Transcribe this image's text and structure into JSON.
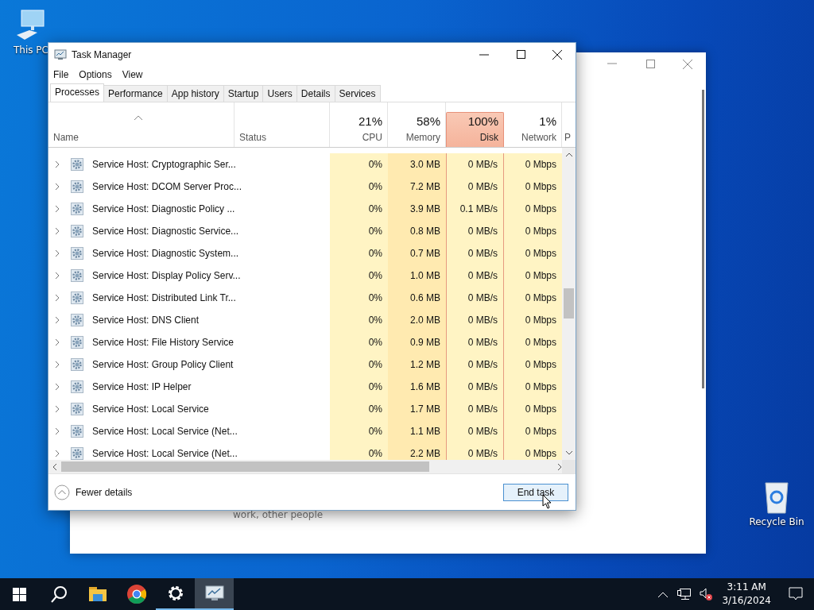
{
  "desktop_icons": [
    {
      "kind": "computer",
      "label": "This PC"
    },
    {
      "kind": "recycle",
      "label": "Recycle Bin"
    }
  ],
  "background_window": {
    "text": "work, other people"
  },
  "window": {
    "title": "Task Manager"
  },
  "menu": [
    "File",
    "Options",
    "View"
  ],
  "tabs": [
    {
      "label": "Processes",
      "selected": true
    },
    {
      "label": "Performance",
      "selected": false
    },
    {
      "label": "App history",
      "selected": false
    },
    {
      "label": "Startup",
      "selected": false
    },
    {
      "label": "Users",
      "selected": false
    },
    {
      "label": "Details",
      "selected": false
    },
    {
      "label": "Services",
      "selected": false
    }
  ],
  "columns": [
    {
      "label": "Name",
      "alert": false
    },
    {
      "label": "Status",
      "alert": false
    },
    {
      "label": "CPU",
      "value": "21%",
      "alert": false
    },
    {
      "label": "Memory",
      "value": "58%",
      "alert": false
    },
    {
      "label": "Disk",
      "value": "100%",
      "alert": true
    },
    {
      "label": "Network",
      "value": "1%",
      "alert": false
    },
    {
      "label": "P",
      "alert": false
    }
  ],
  "rows": [
    {
      "name": "Service Host: Cryptographic Ser...",
      "cpu": "0%",
      "memory": "3.0 MB",
      "disk": "0 MB/s",
      "network": "0 Mbps"
    },
    {
      "name": "Service Host: DCOM Server Proc...",
      "cpu": "0%",
      "memory": "7.2 MB",
      "disk": "0 MB/s",
      "network": "0 Mbps"
    },
    {
      "name": "Service Host: Diagnostic Policy ...",
      "cpu": "0%",
      "memory": "3.9 MB",
      "disk": "0.1 MB/s",
      "network": "0 Mbps"
    },
    {
      "name": "Service Host: Diagnostic Service...",
      "cpu": "0%",
      "memory": "0.8 MB",
      "disk": "0 MB/s",
      "network": "0 Mbps"
    },
    {
      "name": "Service Host: Diagnostic System...",
      "cpu": "0%",
      "memory": "0.7 MB",
      "disk": "0 MB/s",
      "network": "0 Mbps"
    },
    {
      "name": "Service Host: Display Policy Serv...",
      "cpu": "0%",
      "memory": "1.0 MB",
      "disk": "0 MB/s",
      "network": "0 Mbps"
    },
    {
      "name": "Service Host: Distributed Link Tr...",
      "cpu": "0%",
      "memory": "0.6 MB",
      "disk": "0 MB/s",
      "network": "0 Mbps"
    },
    {
      "name": "Service Host: DNS Client",
      "cpu": "0%",
      "memory": "2.0 MB",
      "disk": "0 MB/s",
      "network": "0 Mbps"
    },
    {
      "name": "Service Host: File History Service",
      "cpu": "0%",
      "memory": "0.9 MB",
      "disk": "0 MB/s",
      "network": "0 Mbps"
    },
    {
      "name": "Service Host: Group Policy Client",
      "cpu": "0%",
      "memory": "1.2 MB",
      "disk": "0 MB/s",
      "network": "0 Mbps"
    },
    {
      "name": "Service Host: IP Helper",
      "cpu": "0%",
      "memory": "1.6 MB",
      "disk": "0 MB/s",
      "network": "0 Mbps"
    },
    {
      "name": "Service Host: Local Service",
      "cpu": "0%",
      "memory": "1.7 MB",
      "disk": "0 MB/s",
      "network": "0 Mbps"
    },
    {
      "name": "Service Host: Local Service (Net...",
      "cpu": "0%",
      "memory": "1.1 MB",
      "disk": "0 MB/s",
      "network": "0 Mbps"
    },
    {
      "name": "Service Host: Local Service (Net...",
      "cpu": "0%",
      "memory": "2.2 MB",
      "disk": "0 MB/s",
      "network": "0 Mbps"
    }
  ],
  "footer": {
    "details_label": "Fewer details",
    "end_task": "End task"
  },
  "taskbar": {
    "apps": [
      {
        "kind": "start",
        "running": false,
        "active": false
      },
      {
        "kind": "search",
        "running": false,
        "active": false
      },
      {
        "kind": "folder",
        "running": false,
        "active": false
      },
      {
        "kind": "browser",
        "running": false,
        "active": false
      },
      {
        "kind": "settings",
        "running": true,
        "active": false
      },
      {
        "kind": "monitor",
        "running": true,
        "active": true
      }
    ],
    "time": "3:11 AM",
    "date": "3/16/2024"
  }
}
